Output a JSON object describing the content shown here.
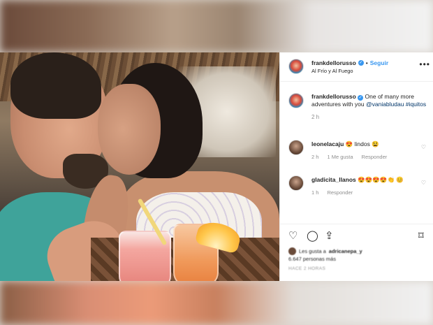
{
  "post": {
    "username": "frankdellorusso",
    "follow_label": "Seguir",
    "location": "Al Frío y Al Fuego",
    "caption_text": "One of many more adventures with you",
    "caption_mention": "@vaniabludau",
    "caption_hashtag": "#iquitos",
    "caption_age": "2 h"
  },
  "comments": [
    {
      "username": "leonelacaju",
      "text": "😍 lindos 😫",
      "age": "2 h",
      "likes": "1 Me gusta",
      "reply_label": "Responder"
    },
    {
      "username": "gladicita_llanos",
      "text": "😍😍😍😍👏 😊",
      "age": "1 h",
      "reply_label": "Responder"
    }
  ],
  "likes_line1_prefix": "Les gusta a",
  "likes_line1_user": "adricanepa_y",
  "likes_line2": "6.647 personas más",
  "posted_label": "HACE 2 HORAS",
  "icons": {
    "like": "heart-icon",
    "comment": "comment-icon",
    "share": "share-icon",
    "save": "bookmark-icon",
    "more": "more-options-icon",
    "verified": "verified-badge-icon"
  },
  "colors": {
    "link": "#3897f0",
    "mention": "#003569",
    "meta": "#8e8e8e"
  }
}
